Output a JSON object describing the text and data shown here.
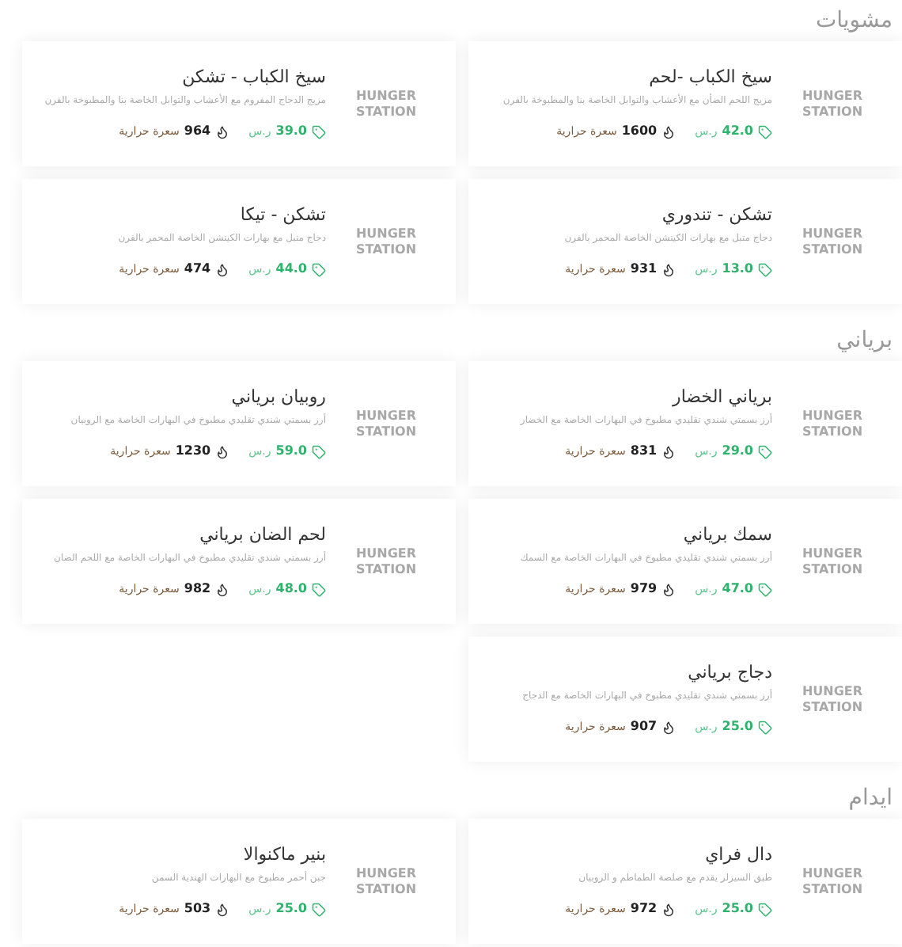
{
  "sections": [
    {
      "title": "مشويات",
      "items": [
        {
          "name": "سيخ الكباب -لحم",
          "description": "مزيج اللحم الضأن مع الأعشاب والتوابل الخاصة بنا والمطبوخة بالفرن",
          "price": "42.0",
          "currency": "ر.س",
          "calories": "1600",
          "calories_label": "سعرة حرارية",
          "logo": [
            "HUNGER",
            "STATION"
          ]
        },
        {
          "name": "سيخ الكباب - تشكن",
          "description": "مزيج الدجاج المفروم مع الأعشاب والتوابل الخاصة بنا والمطبوخة بالفرن",
          "price": "39.0",
          "currency": "ر.س",
          "calories": "964",
          "calories_label": "سعرة حرارية",
          "logo": [
            "HUNGER",
            "STATION"
          ]
        },
        {
          "name": "تشكن - تندوري",
          "description": "دجاج متبل مع بهارات الكيتشن الخاصة المحمر بالفرن",
          "price": "13.0",
          "currency": "ر.س",
          "calories": "931",
          "calories_label": "سعرة حرارية",
          "logo": [
            "HUNGER",
            "STATION"
          ]
        },
        {
          "name": "تشكن - تيكا",
          "description": "دجاج متبل مع بهارات الكيتشن الخاصة المحمر بالفرن",
          "price": "44.0",
          "currency": "ر.س",
          "calories": "474",
          "calories_label": "سعرة حرارية",
          "logo": [
            "HUNGER",
            "STATION"
          ]
        }
      ]
    },
    {
      "title": "برياني",
      "items": [
        {
          "name": "برياني الخضار",
          "description": "أرز بسمتي شندي تقليدي مطبوخ في البهارات الخاصة مع الخضار",
          "price": "29.0",
          "currency": "ر.س",
          "calories": "831",
          "calories_label": "سعرة حرارية",
          "logo": [
            "HUNGER",
            "STATION"
          ]
        },
        {
          "name": "روبيان برياني",
          "description": "أرز بسمتي شندي تقليدي مطبوخ في البهارات الخاصة مع الروبيان",
          "price": "59.0",
          "currency": "ر.س",
          "calories": "1230",
          "calories_label": "سعرة حرارية",
          "logo": [
            "HUNGER",
            "STATION"
          ]
        },
        {
          "name": "سمك برياني",
          "description": "أرز بسمتي شندي تقليدي مطبوخ في البهارات الخاصة مع السمك",
          "price": "47.0",
          "currency": "ر.س",
          "calories": "979",
          "calories_label": "سعرة حرارية",
          "logo": [
            "HUNGER",
            "STATION"
          ]
        },
        {
          "name": "لحم الضان برياني",
          "description": "أرز بسمتي شندي تقليدي مطبوخ في البهارات الخاصة مع اللحم الضان",
          "price": "48.0",
          "currency": "ر.س",
          "calories": "982",
          "calories_label": "سعرة حرارية",
          "logo": [
            "HUNGER",
            "STATION"
          ]
        },
        {
          "name": "دجاج برياني",
          "description": "أرز بسمتي شندي تقليدي مطبوخ في البهارات الخاصة مع الدجاج",
          "price": "25.0",
          "currency": "ر.س",
          "calories": "907",
          "calories_label": "سعرة حرارية",
          "logo": [
            "HUNGER",
            "STATION"
          ]
        }
      ]
    },
    {
      "title": "ايدام",
      "items": [
        {
          "name": "دال فراي",
          "description": "طبق السيزلر يقدم مع صلصة الطماطم و الروبيان",
          "price": "25.0",
          "currency": "ر.س",
          "calories": "972",
          "calories_label": "سعرة حرارية",
          "logo": [
            "HUNGER",
            "STATION"
          ]
        },
        {
          "name": "بنير ماكنوالا",
          "description": "جبن أحمر مطبوخ مع البهارات الهندية السمن",
          "price": "25.0",
          "currency": "ر.س",
          "calories": "503",
          "calories_label": "سعرة حرارية",
          "logo": [
            "HUNGER",
            "STATION"
          ]
        }
      ]
    }
  ]
}
